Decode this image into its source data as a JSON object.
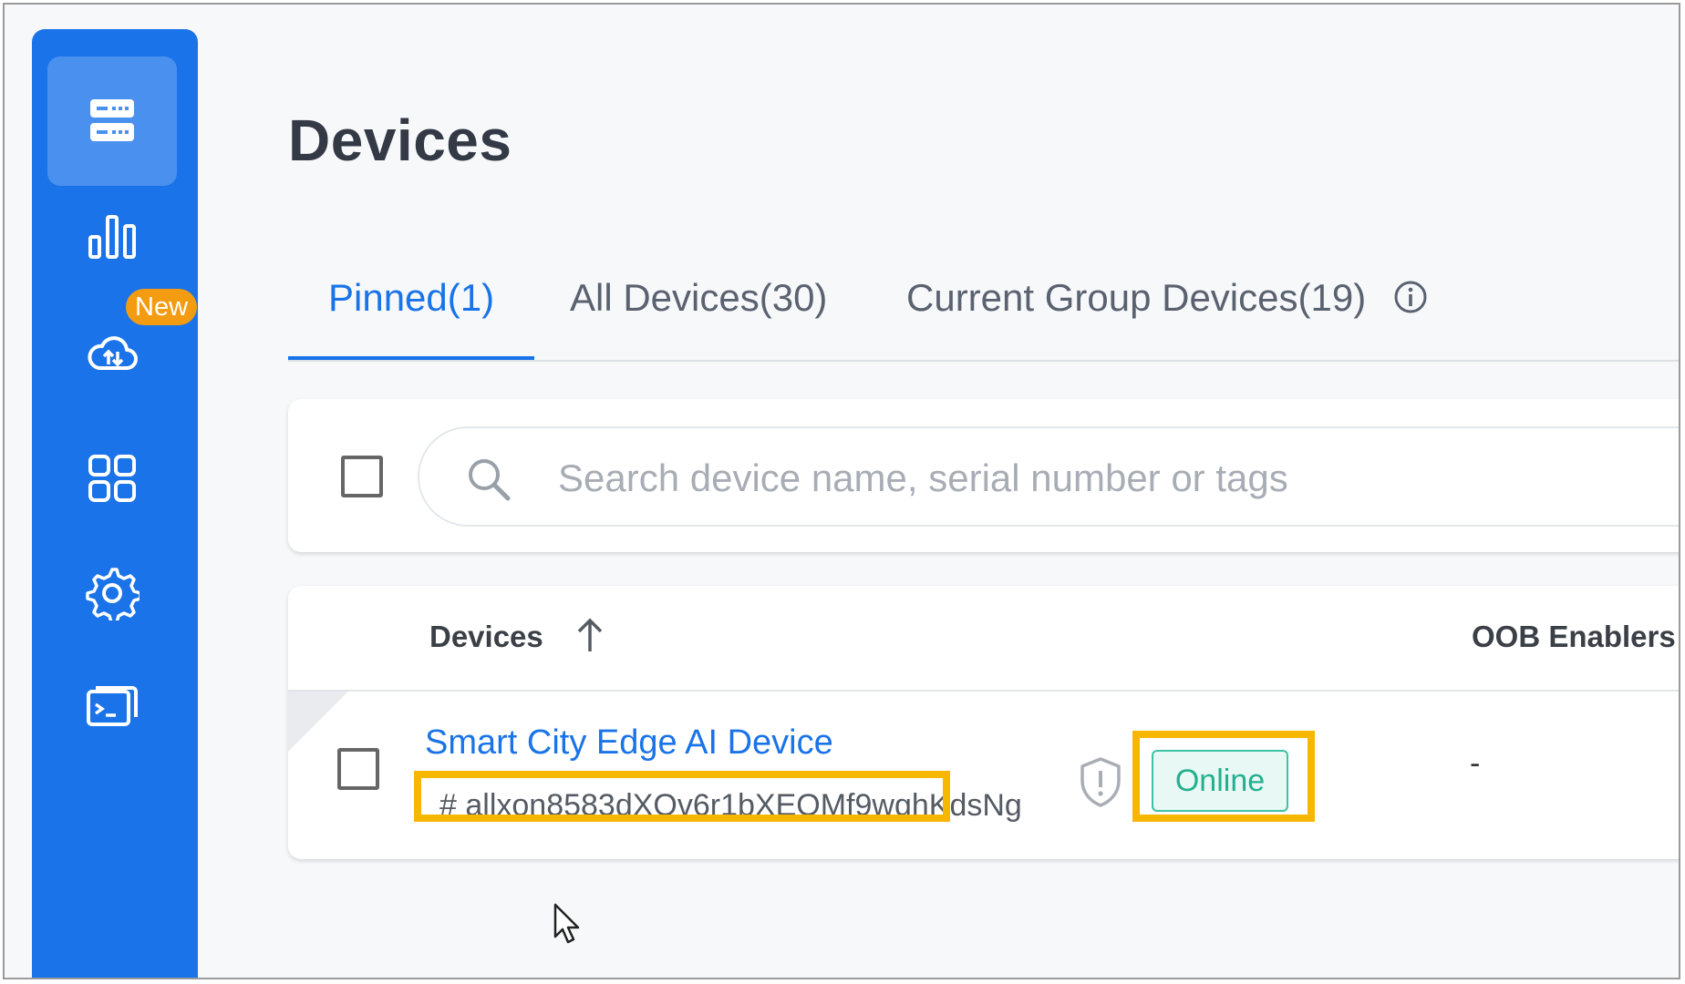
{
  "page": {
    "title": "Devices"
  },
  "sidebar": {
    "items": [
      {
        "id": "devices",
        "icon": "server-icon",
        "active": true
      },
      {
        "id": "analytics",
        "icon": "bar-chart-icon",
        "active": false
      },
      {
        "id": "cloud-update",
        "icon": "cloud-sync-icon",
        "active": false,
        "badge": "New"
      },
      {
        "id": "apps",
        "icon": "apps-grid-icon",
        "active": false
      },
      {
        "id": "settings",
        "icon": "gear-icon",
        "active": false
      },
      {
        "id": "remote-terminal",
        "icon": "terminal-icon",
        "active": false
      }
    ]
  },
  "tabs": [
    {
      "label": "Pinned(1)",
      "active": true
    },
    {
      "label": "All Devices(30)",
      "active": false
    },
    {
      "label": "Current Group Devices(19)",
      "active": false
    }
  ],
  "search": {
    "placeholder": "Search device name, serial number or tags",
    "value": ""
  },
  "table": {
    "columns": [
      "Devices",
      "OOB Enablers"
    ],
    "sort": {
      "column": "Devices",
      "direction": "ascending"
    },
    "rows": [
      {
        "name": "Smart City Edge AI Device",
        "serial": "# allxon8583dXOv6r1bXEOMf9wghKdsNg",
        "status": "Online",
        "oob_enablers": "-"
      }
    ]
  },
  "colors": {
    "sidebar": "#1a73e8",
    "accent": "#1a73e8",
    "online": "#23b08e",
    "highlight": "#f7b600",
    "badge": "#f39c12"
  }
}
